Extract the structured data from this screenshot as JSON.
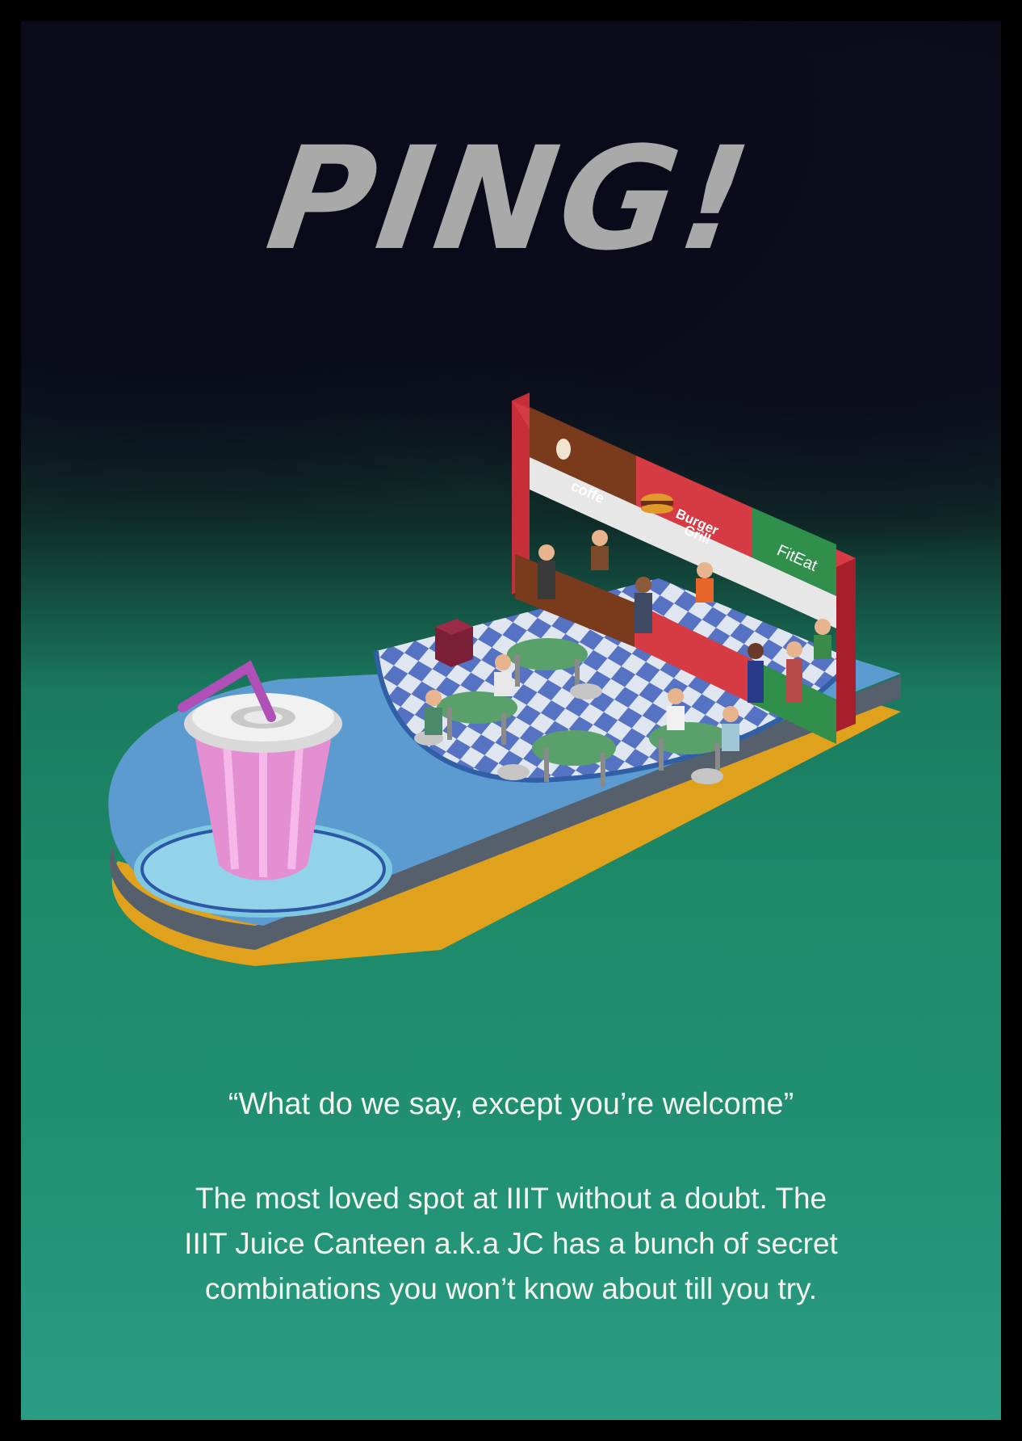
{
  "title": "PING!",
  "stalls": {
    "coffee": "coffe",
    "burger_line1": "Burger",
    "burger_line2": "Grill",
    "fiteat": "FitEat"
  },
  "quote": "“What do we say, except you’re welcome”",
  "description": [
    "The most loved spot at IIIT without a doubt. The",
    "IIIT Juice Canteen a.k.a JC has a bunch of secret",
    "combinations you won’t know about till you try."
  ],
  "colors": {
    "frame": "#000000",
    "sky": "#0a0a1a",
    "green": "#1d8a69",
    "title": "#a9a9a9",
    "platform": "#5b9bd0",
    "platform_base": "#e0a11c"
  }
}
